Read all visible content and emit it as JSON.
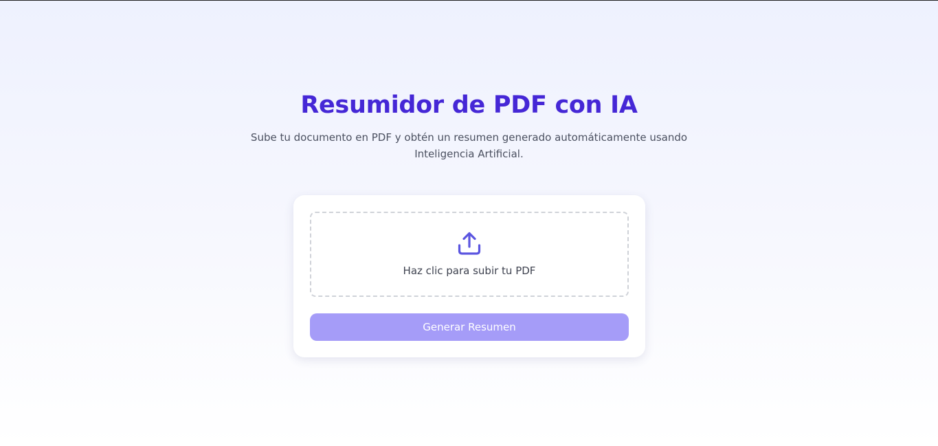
{
  "header": {
    "title": "Resumidor de PDF con IA",
    "subtitle": "Sube tu documento en PDF y obtén un resumen generado automáticamente usando Inteligencia Artificial."
  },
  "upload": {
    "icon": "upload-icon",
    "label": "Haz clic para subir tu PDF"
  },
  "actions": {
    "generate_label": "Generar Resumen",
    "generate_state": "disabled"
  },
  "colors": {
    "accent": "#4527d6",
    "icon": "#5b55e0",
    "button_disabled": "#a59cf8",
    "text": "#3f4350"
  }
}
